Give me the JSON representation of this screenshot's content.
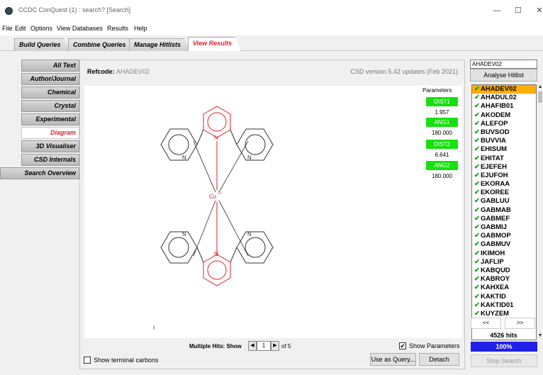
{
  "window": {
    "title": "CCDC ConQuest (1) : search? [Search]",
    "controls": [
      "—",
      "☐",
      "✕"
    ]
  },
  "menu": [
    "File",
    "Edit",
    "Options",
    "View Databases",
    "Results",
    "Help"
  ],
  "tabs": [
    "Build Queries",
    "Combine Queries",
    "Manage Hitlists",
    "View Results"
  ],
  "left_nav": [
    "All Text",
    "Author/Journal",
    "Chemical",
    "Crystal",
    "Experimental",
    "Diagram",
    "3D Visualiser",
    "CSD Internals",
    "Search Overview"
  ],
  "panel": {
    "refcode_label": "Refcode:",
    "refcode_value": "AHADEV02",
    "version": "CSD version 5.42 updates (Feb 2021)"
  },
  "diagram": {
    "metal_label": "Co",
    "metal_charge": "2+",
    "nitrogen_label": "N",
    "stray_mark": "I"
  },
  "parameters": {
    "title": "Parameters",
    "items": [
      {
        "name": "DIST1",
        "value": "1.957"
      },
      {
        "name": "ANG1",
        "value": "180.000"
      },
      {
        "name": "DIST2",
        "value": "6.641"
      },
      {
        "name": "ANG2",
        "value": "180.000"
      }
    ],
    "accent_color": "#17e00e"
  },
  "bottom": {
    "multiple_hits_label": "Multiple Hits: Show",
    "hit_index": "1",
    "of_label": "of 5",
    "show_parameters_label": "Show Parameters",
    "show_parameters_checked": true,
    "show_terminal_label": "Show terminal carbons",
    "show_terminal_checked": false,
    "use_as_query_label": "Use as Query...",
    "detach_label": "Detach"
  },
  "hitlist": {
    "current": "AHADEV02",
    "analyse_label": "Analyse Hitlist",
    "items": [
      "AHADEV02",
      "AHADUL02",
      "AHAFIB01",
      "AKODEM",
      "ALEFOP",
      "BUVSOD",
      "BUVVIA",
      "EHISUM",
      "EHITAT",
      "EJEFEH",
      "EJUFOH",
      "EKORAA",
      "EKOREE",
      "GABLUU",
      "GABMAB",
      "GABMEF",
      "GABMIJ",
      "GABMOP",
      "GABMUV",
      "IKIMOH",
      "JAFLIP",
      "KABQUD",
      "KABROY",
      "KAHXEA",
      "KAKTID",
      "KAKTID01",
      "KUYZEM"
    ],
    "selected_index": 0,
    "prev_label": "<<",
    "next_label": ">>",
    "hits_label": "4526 hits",
    "progress_label": "100%",
    "progress_fraction": 1.0,
    "stop_label": "Stop Search",
    "selected_color": "#ffae00",
    "progress_color": "#2020e8"
  }
}
